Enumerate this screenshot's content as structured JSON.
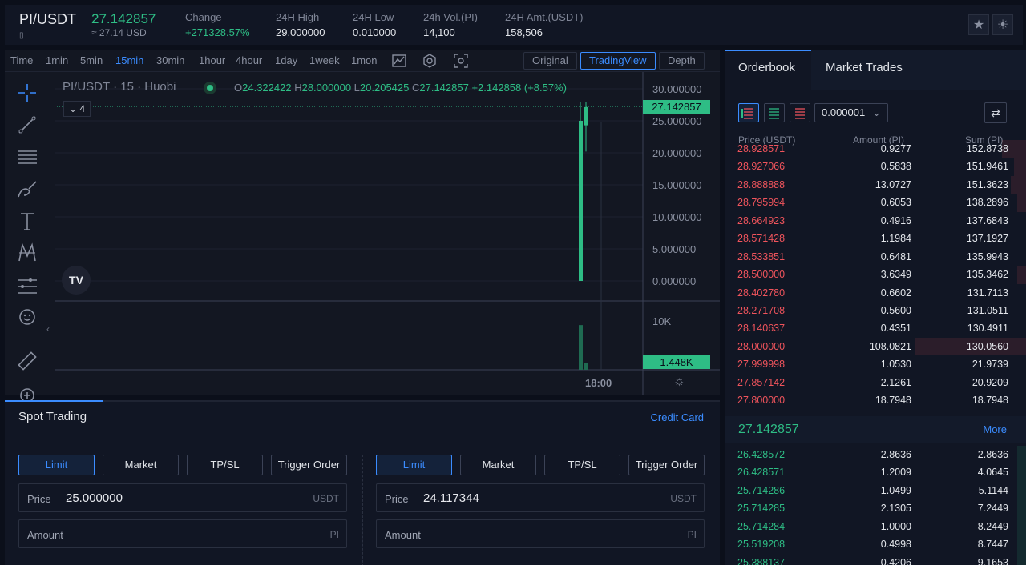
{
  "header": {
    "pair": "PI/USDT",
    "last_price": "27.142857",
    "last_price_usd": "≈ 27.14 USD",
    "stats": [
      {
        "label": "Change",
        "value": "+271328.57%",
        "green": true
      },
      {
        "label": "24H High",
        "value": "29.000000"
      },
      {
        "label": "24H Low",
        "value": "0.010000"
      },
      {
        "label": "24h Vol.(PI)",
        "value": "14,100"
      },
      {
        "label": "24H Amt.(USDT)",
        "value": "158,506"
      }
    ],
    "buttons": {
      "favorite_icon": "star-icon",
      "theme_icon": "sun-icon"
    }
  },
  "chart_toolbar": {
    "intervals": [
      "Time",
      "1min",
      "5min",
      "15min",
      "30min",
      "1hour",
      "4hour",
      "1day",
      "1week",
      "1mon"
    ],
    "active_interval": "15min",
    "views": [
      "Original",
      "TradingView",
      "Depth"
    ],
    "active_view": "TradingView"
  },
  "chart": {
    "legend_symbol": "PI/USDT · 15 · Huobi",
    "legend_o": "24.322422",
    "legend_h": "28.000000",
    "legend_l": "20.205425",
    "legend_c": "27.142857",
    "legend_change": "+2.142858 (+8.57%)",
    "indicator_count": "4",
    "current_price_tag": "27.142857",
    "volume_tag": "1.448K",
    "time_label": "18:00",
    "logo_text": "TV"
  },
  "chart_data": {
    "type": "candlestick",
    "price_axis_ticks": [
      "30.000000",
      "25.000000",
      "20.000000",
      "15.000000",
      "10.000000",
      "5.000000",
      "0.000000"
    ],
    "volume_axis_ticks": [
      "10K"
    ],
    "candles": [
      {
        "open": 0.0,
        "high": 28.0,
        "low": 0.0,
        "close": 25.0,
        "color": "up"
      },
      {
        "open": 24.3,
        "high": 28.0,
        "low": 20.2,
        "close": 27.14,
        "color": "up"
      }
    ],
    "volumes": [
      9800,
      1448
    ]
  },
  "orderbook": {
    "tabs": [
      "Orderbook",
      "Market Trades"
    ],
    "active_tab": "Orderbook",
    "precision": "0.000001",
    "columns": [
      "Price (USDT)",
      "Amount (PI)",
      "Sum (PI)"
    ],
    "asks": [
      {
        "price": "28.928571",
        "amount": "0.9277",
        "sum": "152.8738",
        "depth": 0.08
      },
      {
        "price": "28.927066",
        "amount": "0.5838",
        "sum": "151.9461",
        "depth": 0.04
      },
      {
        "price": "28.888888",
        "amount": "13.0727",
        "sum": "151.3623",
        "depth": 0.05
      },
      {
        "price": "28.795994",
        "amount": "0.6053",
        "sum": "138.2896",
        "depth": 0.03
      },
      {
        "price": "28.664923",
        "amount": "0.4916",
        "sum": "137.6843",
        "depth": 0.0
      },
      {
        "price": "28.571428",
        "amount": "1.1984",
        "sum": "137.1927",
        "depth": 0.0
      },
      {
        "price": "28.533851",
        "amount": "0.6481",
        "sum": "135.9943",
        "depth": 0.0
      },
      {
        "price": "28.500000",
        "amount": "3.6349",
        "sum": "135.3462",
        "depth": 0.03
      },
      {
        "price": "28.402780",
        "amount": "0.6602",
        "sum": "131.7113",
        "depth": 0.0
      },
      {
        "price": "28.271708",
        "amount": "0.5600",
        "sum": "131.0511",
        "depth": 0.0
      },
      {
        "price": "28.140637",
        "amount": "0.4351",
        "sum": "130.4911",
        "depth": 0.0
      },
      {
        "price": "28.000000",
        "amount": "108.0821",
        "sum": "130.0560",
        "depth": 0.37
      },
      {
        "price": "27.999998",
        "amount": "1.0530",
        "sum": "21.9739",
        "depth": 0.0
      },
      {
        "price": "27.857142",
        "amount": "2.1261",
        "sum": "20.9209",
        "depth": 0.0
      },
      {
        "price": "27.800000",
        "amount": "18.7948",
        "sum": "18.7948",
        "depth": 0.0
      }
    ],
    "mid_price": "27.142857",
    "more_label": "More",
    "bids": [
      {
        "price": "26.428572",
        "amount": "2.8636",
        "sum": "2.8636",
        "depth": 0.03
      },
      {
        "price": "26.428571",
        "amount": "1.2009",
        "sum": "4.0645",
        "depth": 0.03
      },
      {
        "price": "25.714286",
        "amount": "1.0499",
        "sum": "5.1144",
        "depth": 0.03
      },
      {
        "price": "25.714285",
        "amount": "2.1305",
        "sum": "7.2449",
        "depth": 0.03
      },
      {
        "price": "25.714284",
        "amount": "1.0000",
        "sum": "8.2449",
        "depth": 0.03
      },
      {
        "price": "25.519208",
        "amount": "0.4998",
        "sum": "8.7447",
        "depth": 0.03
      },
      {
        "price": "25.388137",
        "amount": "0.4206",
        "sum": "9.1653",
        "depth": 0.03
      }
    ]
  },
  "trading": {
    "tab": "Spot Trading",
    "credit_card": "Credit Card",
    "order_types": [
      "Limit",
      "Market",
      "TP/SL",
      "Trigger Order"
    ],
    "buy": {
      "price_label": "Price",
      "price_value": "25.000000",
      "price_unit": "USDT",
      "amount_label": "Amount",
      "amount_unit": "PI"
    },
    "sell": {
      "price_label": "Price",
      "price_value": "24.117344",
      "price_unit": "USDT",
      "amount_label": "Amount",
      "amount_unit": "PI"
    }
  },
  "colors": {
    "up": "#2ebd85",
    "down": "#f0545c",
    "accent": "#3b8cff",
    "bg": "#0b0f1a"
  }
}
